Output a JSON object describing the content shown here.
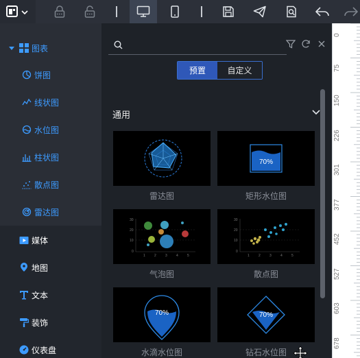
{
  "toolbar": {
    "icons": [
      "layout-icon",
      "lock-icon",
      "unlock-icon",
      "divider",
      "desktop-icon",
      "mobile-icon",
      "divider",
      "save-icon",
      "send-icon",
      "preview-icon",
      "undo-icon",
      "redo-icon"
    ]
  },
  "sidebar": {
    "category": "图表",
    "sub_items": [
      {
        "label": "饼图",
        "icon": "pie-chart-icon"
      },
      {
        "label": "线状图",
        "icon": "line-chart-icon"
      },
      {
        "label": "水位图",
        "icon": "water-level-icon"
      },
      {
        "label": "柱状图",
        "icon": "bar-chart-icon"
      },
      {
        "label": "散点图",
        "icon": "scatter-chart-icon"
      },
      {
        "label": "雷达图",
        "icon": "radar-chart-icon"
      }
    ],
    "top_items": [
      {
        "label": "媒体",
        "icon": "media-icon"
      },
      {
        "label": "地图",
        "icon": "map-pin-icon"
      },
      {
        "label": "文本",
        "icon": "text-icon"
      },
      {
        "label": "装饰",
        "icon": "paint-roller-icon"
      },
      {
        "label": "仪表盘",
        "icon": "dashboard-icon"
      }
    ]
  },
  "panel": {
    "search_placeholder": "",
    "tabs": {
      "preset": "预置",
      "custom": "自定义"
    },
    "section_title": "通用",
    "cards": [
      {
        "label": "雷达图"
      },
      {
        "label": "矩形水位图",
        "value": "70%"
      },
      {
        "label": "气泡图"
      },
      {
        "label": "散点图"
      },
      {
        "label": "水滴水位图",
        "value": "70%"
      },
      {
        "label": "钻石水位图",
        "value": "70%"
      }
    ]
  },
  "ruler": {
    "marks": [
      "0",
      "75",
      "150",
      "226",
      "301",
      "377",
      "452",
      "527",
      "603",
      "678"
    ]
  },
  "colors": {
    "accent": "#3d9bff",
    "active_tab": "#2f58b8",
    "toolbar_bg": "#2c3039",
    "panel_bg": "#1e2228"
  }
}
